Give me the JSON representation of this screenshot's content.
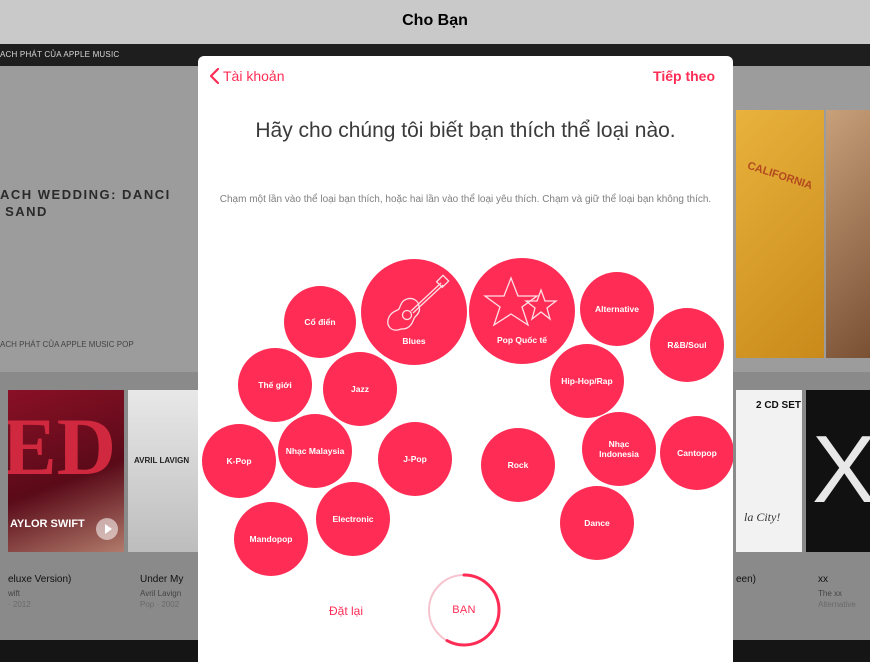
{
  "background": {
    "title": "Cho Bạn",
    "section_top": "ACH PHÁT CỦA APPLE MUSIC",
    "playlist_title": "ACH WEDDING: DANCI\n SAND",
    "section_pop": "ACH PHÁT CỦA APPLE MUSIC POP",
    "albums": {
      "red_art": "ED",
      "red_artist_art": "AYLOR SWIFT",
      "red_title": "eluxe Version)",
      "red_sub1": "wift",
      "red_sub2": "· 2012",
      "avril_art": "AVRIL LAVIGN",
      "avril_title": "Under My",
      "avril_sub1": "Avril Lavign",
      "avril_sub2": "Pop · 2002",
      "yellow_art": "CALIFORNIA",
      "cd_art": "2 CD SET",
      "cd_script": "la City!",
      "cd_title": "een)",
      "xx_art": "X",
      "xx_title": "xx",
      "xx_sub1": "The xx",
      "xx_sub2": "Alternative"
    }
  },
  "modal": {
    "back_label": "Tài khoản",
    "next_label": "Tiếp theo",
    "heading": "Hãy cho chúng tôi biết bạn thích thể loại nào.",
    "subtext": "Chạm một lần vào thể loại bạn thích, hoặc hai lần vào thể loại yêu thích. Chạm và giữ thể loại bạn không thích.",
    "genres": {
      "co_dien": "Cổ điển",
      "blues": "Blues",
      "pop_quoc_te": "Pop Quốc tế",
      "alternative": "Alternative",
      "rnb_soul": "R&B/Soul",
      "the_gioi": "Thế giới",
      "jazz": "Jazz",
      "hiphop_rap": "Hip-Hop/Rap",
      "kpop": "K-Pop",
      "nhac_malaysia": "Nhạc Malaysia",
      "jpop": "J-Pop",
      "rock": "Rock",
      "nhac_indonesia": "Nhạc Indonesia",
      "cantopop": "Cantopop",
      "electronic": "Electronic",
      "dance": "Dance",
      "mandopop": "Mandopop"
    },
    "reset_label": "Đặt lại",
    "done_label": "BẠN",
    "done_progress": 0.58
  },
  "colors": {
    "accent": "#ff2d55"
  }
}
